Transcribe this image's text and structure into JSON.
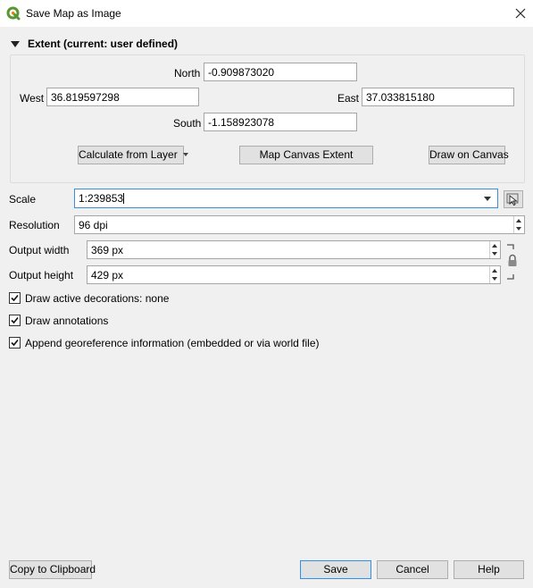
{
  "window": {
    "title": "Save Map as Image",
    "close_icon": "close-icon",
    "app_icon": "qgis-logo-icon"
  },
  "extent": {
    "group_title": "Extent (current: user defined)",
    "north_label": "North",
    "north_value": "-0.909873020",
    "west_label": "West",
    "west_value": "36.819597298",
    "east_label": "East",
    "east_value": "37.033815180",
    "south_label": "South",
    "south_value": "-1.158923078",
    "calc_from_layer": "Calculate from Layer",
    "map_canvas_extent": "Map Canvas Extent",
    "draw_on_canvas": "Draw on Canvas"
  },
  "scale": {
    "label": "Scale",
    "value": "1:239853"
  },
  "resolution": {
    "label": "Resolution",
    "value": "96 dpi"
  },
  "output_width": {
    "label": "Output width",
    "value": "369 px"
  },
  "output_height": {
    "label": "Output height",
    "value": "429 px"
  },
  "options": [
    {
      "label": "Draw active decorations: none",
      "checked": true
    },
    {
      "label": "Draw annotations",
      "checked": true
    },
    {
      "label": "Append georeference information (embedded or via world file)",
      "checked": true
    }
  ],
  "footer": {
    "copy_to_clipboard": "Copy to Clipboard",
    "save": "Save",
    "cancel": "Cancel",
    "help": "Help"
  },
  "colors": {
    "accent": "#3c8fd6",
    "qgis_green": "#589632",
    "qgis_yellow": "#ee7913"
  }
}
